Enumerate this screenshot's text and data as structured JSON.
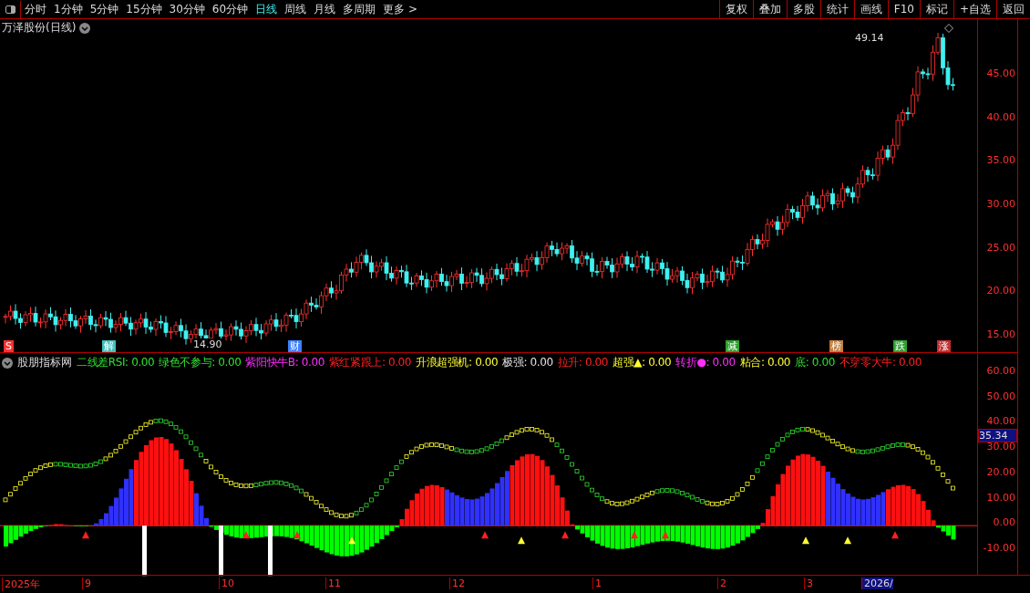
{
  "toolbar": {
    "periods": [
      {
        "label": "分时",
        "selected": false
      },
      {
        "label": "1分钟",
        "selected": false
      },
      {
        "label": "5分钟",
        "selected": false
      },
      {
        "label": "15分钟",
        "selected": false
      },
      {
        "label": "30分钟",
        "selected": false
      },
      {
        "label": "60分钟",
        "selected": false
      },
      {
        "label": "日线",
        "selected": true
      },
      {
        "label": "周线",
        "selected": false
      },
      {
        "label": "月线",
        "selected": false
      },
      {
        "label": "多周期",
        "selected": false
      },
      {
        "label": "更多 >",
        "selected": false
      }
    ],
    "buttons": [
      "复权",
      "叠加",
      "多股",
      "统计",
      "画线",
      "F10",
      "标记",
      "+自选",
      "返回"
    ]
  },
  "main_chart": {
    "title": "万泽股份(日线)",
    "high_label": "49.14",
    "low_label": "14.90",
    "yticks": [
      "45.00",
      "40.00",
      "35.00",
      "30.00",
      "25.00",
      "20.00",
      "15.00"
    ],
    "events": [
      {
        "label": "S",
        "color": "#ff3030"
      },
      {
        "label": "解",
        "color": "#40c0c0"
      },
      {
        "label": "财",
        "color": "#4080ff"
      },
      {
        "label": "减",
        "color": "#30a030"
      },
      {
        "label": "榜",
        "color": "#c08040"
      },
      {
        "label": "跌",
        "color": "#30a030"
      },
      {
        "label": "涨",
        "color": "#c03030"
      }
    ]
  },
  "indicator": {
    "name": "股朋指标网",
    "yticks": [
      "60.00",
      "50.00",
      "40.00",
      "30.00",
      "20.00",
      "10.00",
      "0.00",
      "-10.00"
    ],
    "current_value": "35.34",
    "readouts": [
      {
        "label": "二线差RSI:",
        "value": "0.00",
        "color": "#30e030"
      },
      {
        "label": "绿色不参与:",
        "value": "0.00",
        "color": "#30e030"
      },
      {
        "label": "紫阳快牛B:",
        "value": "0.00",
        "color": "#ff30ff"
      },
      {
        "label": "紫红紧跟上:",
        "value": "0.00",
        "color": "#ff2020"
      },
      {
        "label": "升浪超强机:",
        "value": "0.00",
        "color": "#ffff30"
      },
      {
        "label": "极强:",
        "value": "0.00",
        "color": "#e0e0e0"
      },
      {
        "label": "拉升:",
        "value": "0.00",
        "color": "#ff2020"
      },
      {
        "label": "超强▲:",
        "value": "0.00",
        "color": "#ffff30"
      },
      {
        "label": "转折●:",
        "value": "0.00",
        "color": "#ff30ff"
      },
      {
        "label": "粘合:",
        "value": "0.00",
        "color": "#ffff30"
      },
      {
        "label": "底:",
        "value": "0.00",
        "color": "#30e030"
      },
      {
        "label": "不穿零大牛:",
        "value": "0.00",
        "color": "#ff2020"
      }
    ]
  },
  "time_axis": [
    "2025年",
    "9",
    "10",
    "11",
    "12",
    "1",
    "2",
    "3",
    "2026/"
  ]
}
